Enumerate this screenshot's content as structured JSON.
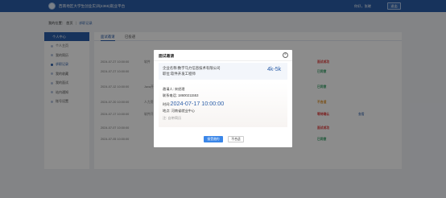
{
  "header": {
    "site_title": "西南地区大学生创业实训(4365)就业平台",
    "user_label": "你好，张晓",
    "logout_label": "退出"
  },
  "breadcrumb": {
    "label": "我的位置：",
    "home": "首页",
    "current": "求职记录"
  },
  "sidebar": {
    "title": "个人中心",
    "items": [
      {
        "label": "个人主页"
      },
      {
        "label": "我的简历"
      },
      {
        "label": "求职记录"
      },
      {
        "label": "我的收藏"
      },
      {
        "label": "我的面试"
      },
      {
        "label": "站内通知"
      },
      {
        "label": "账号设置"
      }
    ]
  },
  "tabs": [
    {
      "label": "面试邀请"
    },
    {
      "label": "已投递"
    }
  ],
  "rows": [
    {
      "time": "2024-07-27 10:00:00",
      "job": "软件",
      "company": "",
      "status": "面试成功",
      "status_color": "#e03c3c",
      "action": ""
    },
    {
      "time": "2024-07-27 10:00:00",
      "job": "",
      "company": "",
      "status": "已同意",
      "status_color": "#38a169",
      "action": ""
    },
    {
      "time": "2024-07-12 10:00:00",
      "job": "Java开",
      "company": "",
      "status": "已同意",
      "status_color": "#38a169",
      "action": ""
    },
    {
      "time": "2024-07-20 10:00:00",
      "job": "人力资",
      "company": "",
      "status": "不合适",
      "status_color": "#dd8a1a",
      "action": ""
    },
    {
      "time": "2024-07-17 10:00:00",
      "job": "软件开",
      "company": "数字马力信息技术有限公司",
      "status": "等待确认",
      "status_color": "#e03c3c",
      "action": "查看"
    },
    {
      "time": "2024-07-07 10:00:00",
      "job": "",
      "company": "",
      "status": "面试成功",
      "status_color": "#e03c3c",
      "action": ""
    },
    {
      "time": "2024-07-05 10:00:00",
      "job": "",
      "company": "",
      "status": "已同意",
      "status_color": "#38a169",
      "action": ""
    }
  ],
  "modal": {
    "title": "面试邀请",
    "close_icon": "close-circle-icon",
    "company_label": "企业名称:",
    "company": "数字马力信息技术有限公司",
    "position_label": "职位:",
    "position": "软件开发工程师",
    "salary": "4k-5k",
    "inviter_label": "邀请人:",
    "inviter": "宋经理",
    "phone_label": "联系电话:",
    "phone": "18600211553",
    "time_label": "时间:",
    "time": "2024-07-17 10:00:00",
    "place_label": "地点:",
    "place": "河南省就业中心",
    "note_label": "注:",
    "note": "自带简历",
    "accept_label": "接受邀约",
    "reject_label": "不合适"
  },
  "colors": {
    "primary": "#2b5da8",
    "accent": "#3a86e8",
    "overlay": "rgba(0,0,0,0.45)"
  }
}
